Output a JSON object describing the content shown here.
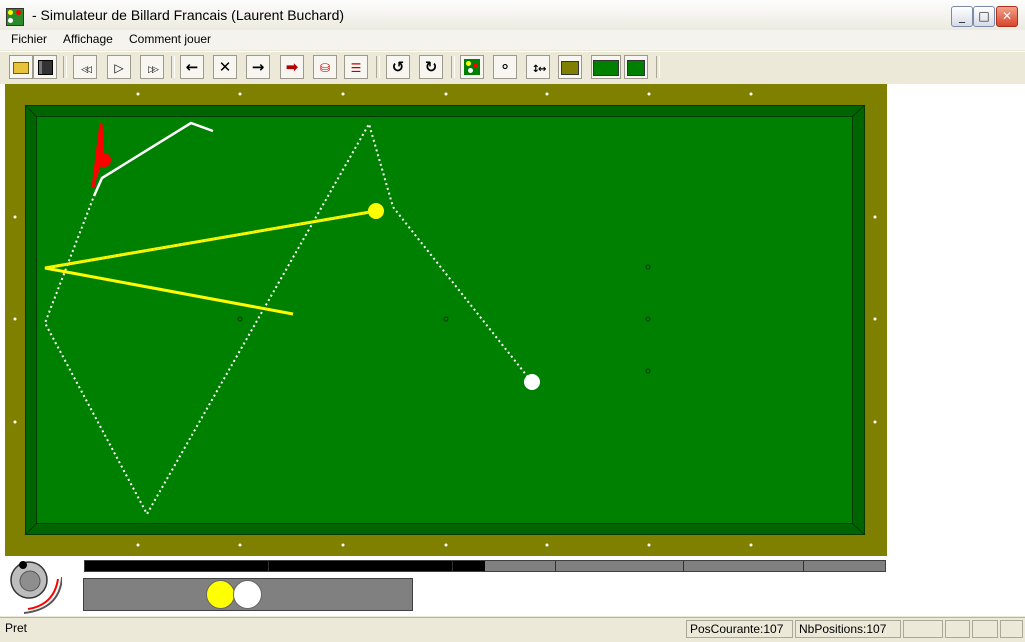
{
  "window": {
    "title": "- Simulateur de Billard Francais (Laurent Buchard)",
    "minimize_label": "_",
    "maximize_label": "□",
    "close_label": "✕"
  },
  "menu": {
    "items": [
      {
        "label": "Fichier"
      },
      {
        "label": "Affichage"
      },
      {
        "label": "Comment jouer"
      }
    ]
  },
  "toolbar": {
    "buttons": [
      {
        "name": "open-file-icon",
        "glyph": "📂"
      },
      {
        "name": "save-icon",
        "glyph": "💾"
      },
      {
        "name": "rewind-icon",
        "glyph": "◁◁"
      },
      {
        "name": "play-icon",
        "glyph": "▷"
      },
      {
        "name": "fast-forward-icon",
        "glyph": "▷▷"
      },
      {
        "name": "arrow-left-icon",
        "glyph": "←"
      },
      {
        "name": "cancel-x-icon",
        "glyph": "✕"
      },
      {
        "name": "arrow-right-icon",
        "glyph": "→"
      },
      {
        "name": "arrow-right-red-icon",
        "glyph": "➡"
      },
      {
        "name": "stack-icon",
        "glyph": "⛁"
      },
      {
        "name": "list-icon",
        "glyph": "☰"
      },
      {
        "name": "rotate-left-icon",
        "glyph": "↺"
      },
      {
        "name": "rotate-right-icon",
        "glyph": "↻"
      },
      {
        "name": "table-view-icon",
        "glyph": "▣"
      },
      {
        "name": "balls-view-icon",
        "glyph": "⚬"
      },
      {
        "name": "resize-icon",
        "glyph": "↕↔"
      },
      {
        "name": "display-icon",
        "glyph": "▤"
      },
      {
        "name": "full-table-icon",
        "glyph": "▦"
      },
      {
        "name": "swap-table-icon",
        "glyph": "⇄"
      }
    ]
  },
  "colors": {
    "cushion": "#808000",
    "rail": "#006400",
    "cloth": "#008000",
    "yellow_ball": "#ffff00",
    "white_ball": "#ffffff",
    "red_ball": "#ff0000"
  },
  "balls": [
    {
      "name": "yellow-ball",
      "color": "#ffff00"
    },
    {
      "name": "white-ball",
      "color": "#ffffff"
    },
    {
      "name": "red-ball",
      "color": "#ff0000"
    }
  ],
  "progress": {
    "current": 107,
    "total": 107,
    "filled_fraction": 0.5
  },
  "ball_panel": {
    "balls": [
      "yellow",
      "white"
    ]
  },
  "status": {
    "text": "Pret",
    "pos_courante": "PosCourante:107",
    "nb_positions": "NbPositions:107"
  }
}
